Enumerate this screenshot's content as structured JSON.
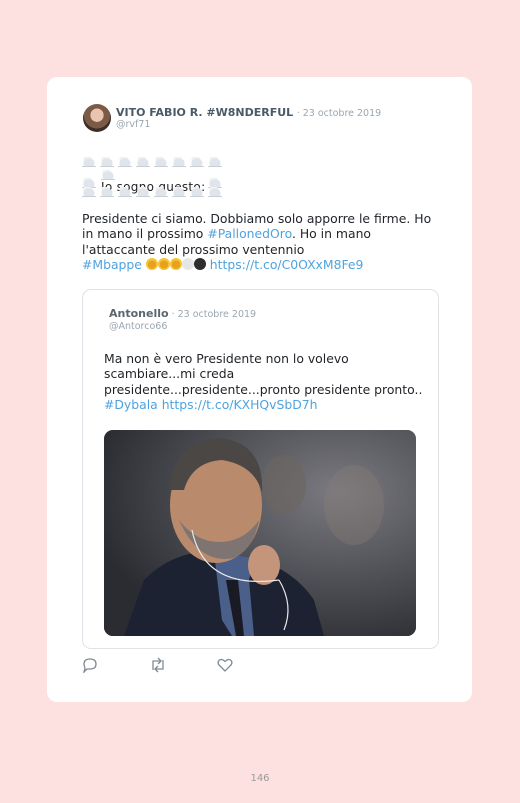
{
  "tweet": {
    "author_name": "VITO FABIO R. #W8NDERFUL",
    "date": "23 octobre 2019",
    "handle": "@rvf71",
    "cloud_caption": "Io sogno questo:",
    "body_main": "Presidente ci siamo. Dobbiamo solo apporre le firme. Ho in mano il prossimo ",
    "hashtag_ballon": "#PallonedOro",
    "body_cont": ". Ho in mano l'attaccante del prossimo ventennio",
    "hashtag_mbappe": "#Mbappe",
    "link": "https://t.co/C0OXxM8Fe9"
  },
  "quoted": {
    "author_name": "Antonello",
    "date": "23 octobre 2019",
    "handle": "@Antorco66",
    "body": "Ma non è vero Presidente non lo volevo scambiare...mi creda presidente...presidente...pronto presidente pronto..",
    "hashtag": "#Dybala",
    "link": "https://t.co/KXHQvSbD7h"
  },
  "icons": [
    "reply-icon",
    "retweet-icon",
    "like-icon"
  ],
  "footer": {
    "page_number": "146"
  }
}
